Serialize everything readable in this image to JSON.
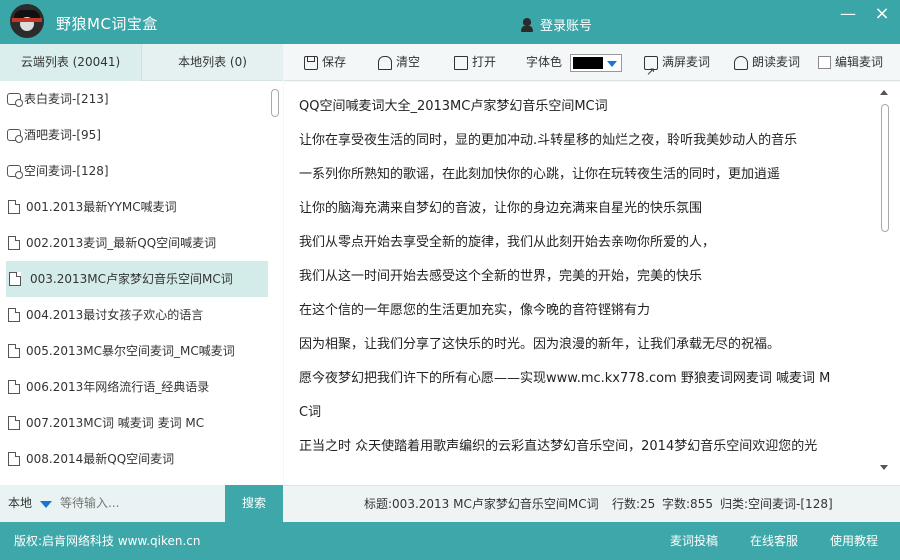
{
  "app": {
    "title": "野狼MC词宝盒",
    "login_label": "登录账号"
  },
  "window": {
    "minimize": "—",
    "close": "×"
  },
  "left_tabs": {
    "cloud": "云端列表 (20041)",
    "local": "本地列表 (0)"
  },
  "list_items": [
    {
      "label": "表白麦词-[213]",
      "type": "folder"
    },
    {
      "label": "酒吧麦词-[95]",
      "type": "folder"
    },
    {
      "label": "空间麦词-[128]",
      "type": "folder"
    },
    {
      "label": "001.2013最新YYMC喊麦词",
      "type": "doc"
    },
    {
      "label": "002.2013麦词_最新QQ空间喊麦词",
      "type": "doc"
    },
    {
      "label": "003.2013MC卢家梦幻音乐空间MC词",
      "type": "doc",
      "selected": true
    },
    {
      "label": "004.2013最讨女孩子欢心的语言",
      "type": "doc"
    },
    {
      "label": "005.2013MC暴尔空间麦词_MC喊麦词",
      "type": "doc"
    },
    {
      "label": "006.2013年网络流行语_经典语录",
      "type": "doc"
    },
    {
      "label": "007.2013MC词 喊麦词 麦词 MC",
      "type": "doc"
    },
    {
      "label": "008.2014最新QQ空间麦词",
      "type": "doc"
    }
  ],
  "toolbar": {
    "save": "保存",
    "clear": "清空",
    "open": "打开",
    "font_color": "字体色",
    "font_color_value": "#000000",
    "fullscreen": "满屏麦词",
    "read_aloud": "朗读麦词",
    "edit": "编辑麦词"
  },
  "editor_lines": [
    "QQ空间喊麦词大全_2013MC卢家梦幻音乐空间MC词",
    "让你在享受夜生活的同时，显的更加冲动.斗转星移的灿烂之夜，聆听我美妙动人的音乐",
    "一系列你所熟知的歌谣，在此刻加快你的心跳，让你在玩转夜生活的同时，更加逍遥",
    "让你的脑海充满来自梦幻的音波，让你的身边充满来自星光的快乐氛围",
    "我们从零点开始去享受全新的旋律，我们从此刻开始去亲吻你所爱的人，",
    "我们从这一时间开始去感受这个全新的世界，完美的开始，完美的快乐",
    "在这个信的一年愿您的生活更加充实，像今晚的音符铿锵有力",
    "因为相聚，让我们分享了这快乐的时光。因为浪漫的新年，让我们承载无尽的祝福。",
    "愿今夜梦幻把我们许下的所有心愿——实现www.mc.kx778.com 野狼麦词网麦词 喊麦词 M",
    "C词",
    "正当之时 众天使踏着用歌声编织的云彩直达梦幻音乐空间，2014梦幻音乐空间欢迎您的光"
  ],
  "search": {
    "scope": "本地",
    "placeholder": "等待输入...",
    "button": "搜索"
  },
  "status": {
    "title": "标题:003.2013 MC卢家梦幻音乐空间MC词",
    "lines": "行数:25",
    "chars": "字数:855",
    "category": "归类:空间麦词-[128]"
  },
  "footer": {
    "copyright": "版权:启肯网络科技 www.qiken.cn",
    "submit": "麦词投稿",
    "support": "在线客服",
    "tutorial": "使用教程"
  }
}
